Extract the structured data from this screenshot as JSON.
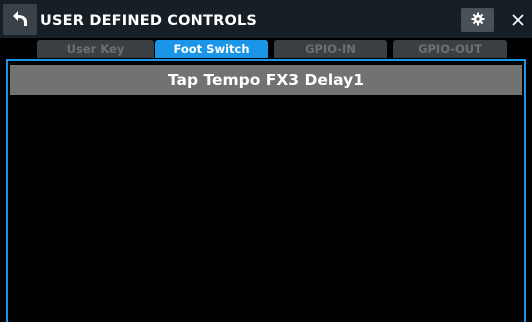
{
  "header": {
    "title": "USER DEFINED CONTROLS",
    "back_icon": "back-arrow-icon",
    "settings_icon": "gear-icon",
    "close_icon": "close-icon"
  },
  "tabs": [
    {
      "label": "User Key",
      "active": false
    },
    {
      "label": "Foot Switch",
      "active": true
    },
    {
      "label": "GPIO-IN",
      "active": false
    },
    {
      "label": "GPIO-OUT",
      "active": false
    }
  ],
  "panel": {
    "assigned_function": "Tap Tempo FX3 Delay1"
  },
  "colors": {
    "accent": "#1a95e8",
    "titlebar_bg": "#171f26",
    "tab_inactive_bg": "#3b3f43",
    "header_bg": "#727272"
  }
}
